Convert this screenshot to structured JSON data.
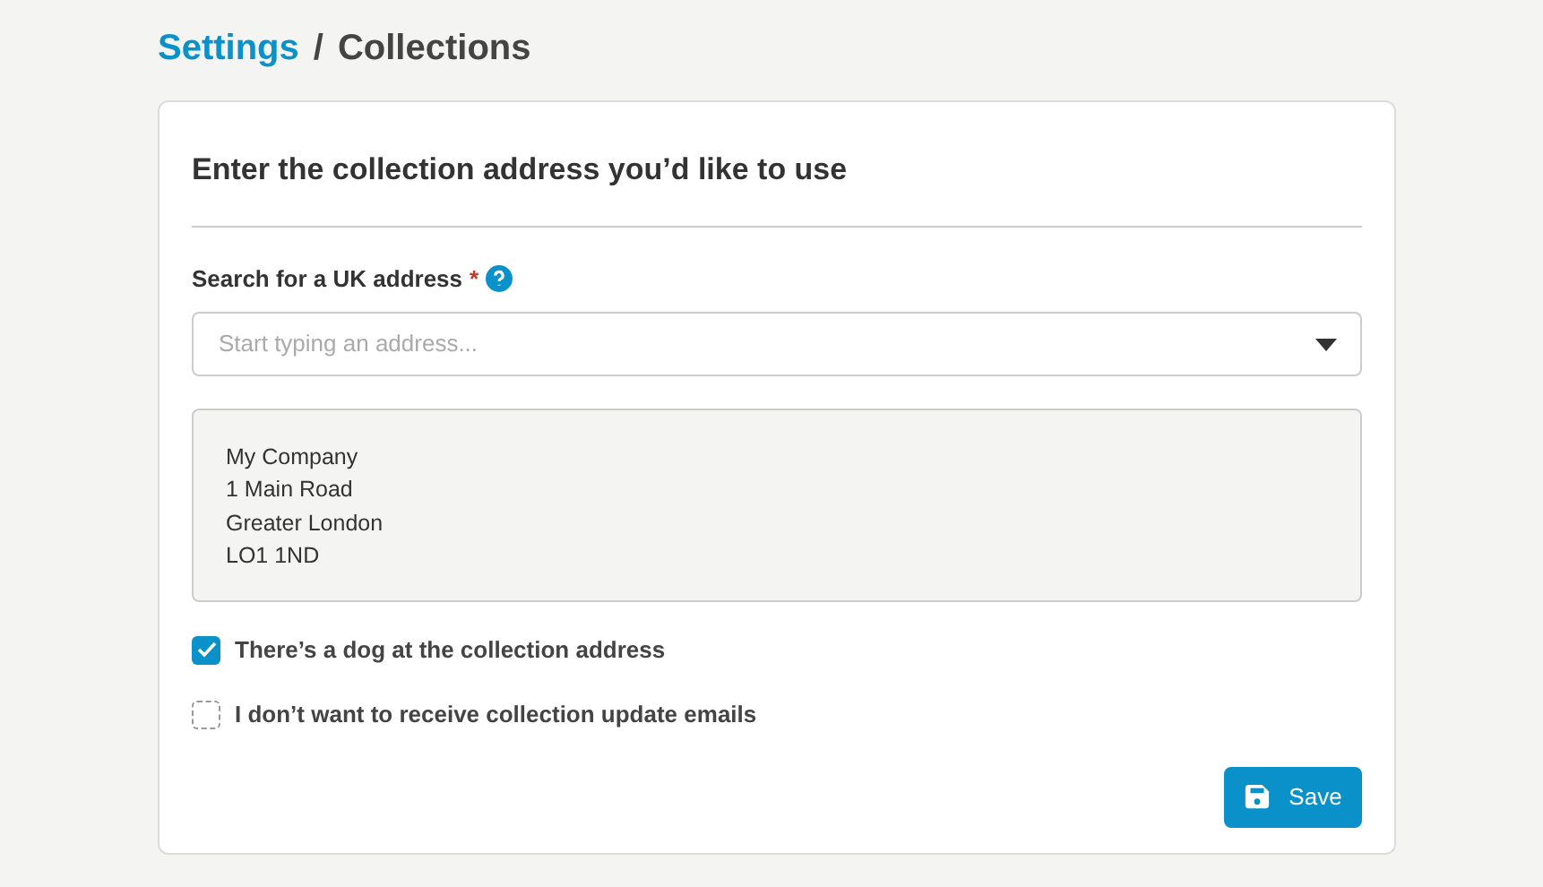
{
  "breadcrumb": {
    "parent": "Settings",
    "separator": "/",
    "current": "Collections"
  },
  "card": {
    "heading": "Enter the collection address you’d like to use",
    "search": {
      "label": "Search for a UK address",
      "required_mark": "*",
      "placeholder": "Start typing an address..."
    },
    "address_lines": [
      "My Company",
      "1 Main Road",
      "Greater London",
      "LO1 1ND"
    ],
    "options": [
      {
        "label": "There’s a dog at the collection address",
        "checked": true
      },
      {
        "label": "I don’t want to receive collection update emails",
        "checked": false
      }
    ],
    "save_button": "Save"
  }
}
